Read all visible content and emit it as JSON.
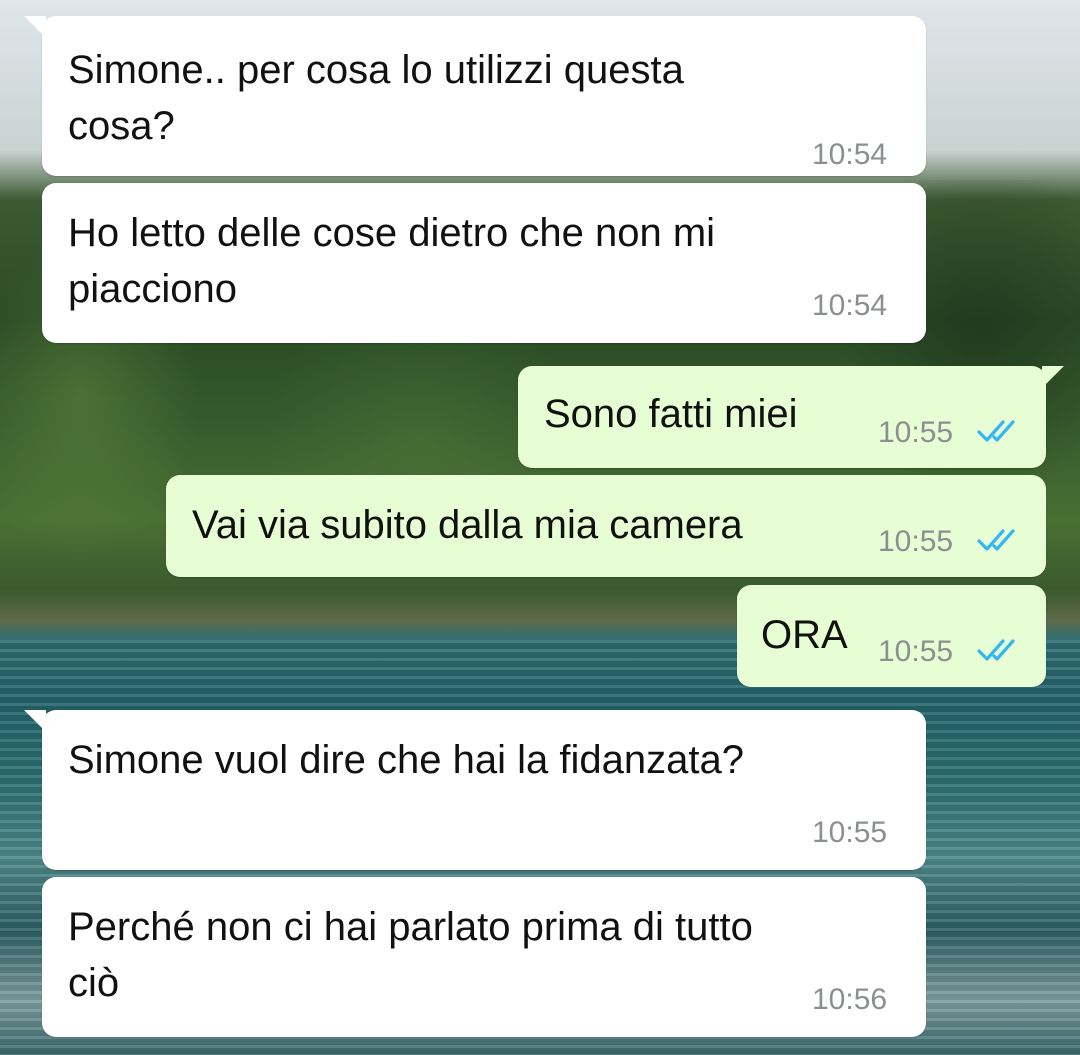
{
  "messages": [
    {
      "direction": "in",
      "text": "Simone.. per cosa lo utilizzi questa\ncosa?",
      "time": "10:54"
    },
    {
      "direction": "in",
      "text": "Ho letto delle cose dietro che non mi\npiacciono",
      "time": "10:54"
    },
    {
      "direction": "out",
      "text": "Sono fatti miei",
      "time": "10:55",
      "status": "read"
    },
    {
      "direction": "out",
      "text": "Vai via subito dalla mia camera",
      "time": "10:55",
      "status": "read"
    },
    {
      "direction": "out",
      "text": "ORA",
      "time": "10:55",
      "status": "read"
    },
    {
      "direction": "in",
      "text": "Simone vuol dire che hai la fidanzata?",
      "time": "10:55"
    },
    {
      "direction": "in",
      "text": "Perché non ci hai parlato prima di tutto\nciò",
      "time": "10:56"
    }
  ],
  "colors": {
    "incoming_bubble": "#ffffff",
    "outgoing_bubble": "#e7fdd3",
    "read_ticks": "#34b7f1",
    "timestamp": "#8c8f91"
  },
  "icons": {
    "read_receipt": "double-check-icon"
  }
}
